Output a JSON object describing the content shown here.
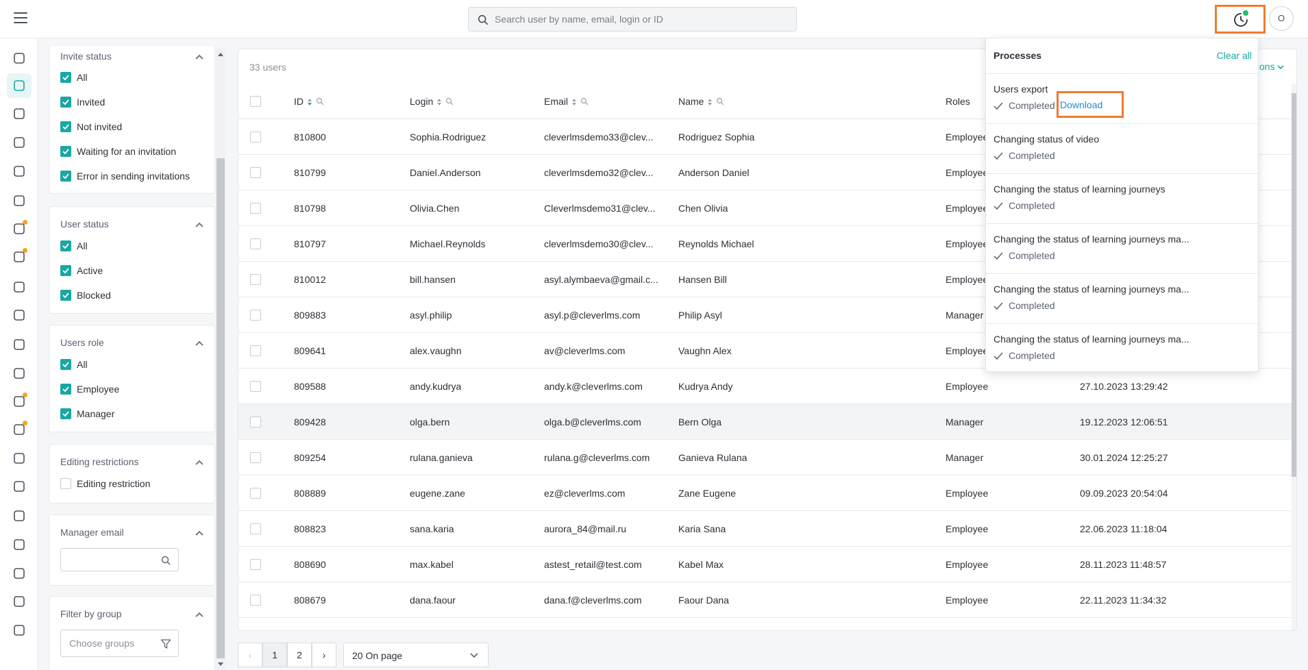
{
  "header": {
    "search_placeholder": "Search user by name, email, login or ID",
    "avatar_initial": "O"
  },
  "rail_icons": [
    "courses-icon",
    "users-icon",
    "settings-icon",
    "analytics-icon",
    "assignments-icon",
    "documents-icon",
    "skills-icon",
    "tasks-icon",
    "copy-icon",
    "help-icon",
    "calendar-icon",
    "info-icon",
    "chat-icon",
    "video-icon",
    "trophy-icon",
    "gift-icon",
    "user-check-icon",
    "trend-icon",
    "star-icon",
    "monitor-icon",
    "external-link-icon"
  ],
  "filters": {
    "invite_status": {
      "title": "Invite status",
      "options": [
        "All",
        "Invited",
        "Not invited",
        "Waiting for an invitation",
        "Error in sending invitations"
      ]
    },
    "user_status": {
      "title": "User status",
      "options": [
        "All",
        "Active",
        "Blocked"
      ]
    },
    "users_role": {
      "title": "Users role",
      "options": [
        "All",
        "Employee",
        "Manager"
      ]
    },
    "editing_restrictions": {
      "title": "Editing restrictions",
      "options": [
        "Editing restriction"
      ]
    },
    "manager_email": {
      "title": "Manager email",
      "placeholder": ""
    },
    "filter_by_group": {
      "title": "Filter by group",
      "placeholder": "Choose groups"
    }
  },
  "table": {
    "count_label": "33 users",
    "actions_peek": "tions",
    "columns": [
      "ID",
      "Login",
      "Email",
      "Name",
      "Roles"
    ],
    "rows": [
      {
        "id": "810800",
        "login": "Sophia.Rodriguez",
        "email": "cleverlmsdemo33@clev...",
        "name": "Rodriguez Sophia",
        "role": "Employee",
        "date": ""
      },
      {
        "id": "810799",
        "login": "Daniel.Anderson",
        "email": "cleverlmsdemo32@clev...",
        "name": "Anderson Daniel",
        "role": "Employee",
        "date": ""
      },
      {
        "id": "810798",
        "login": "Olivia.Chen",
        "email": "Cleverlmsdemo31@clev...",
        "name": "Chen Olivia",
        "role": "Employee",
        "date": ""
      },
      {
        "id": "810797",
        "login": "Michael.Reynolds",
        "email": "cleverlmsdemo30@clev...",
        "name": "Reynolds Michael",
        "role": "Employee",
        "date": ""
      },
      {
        "id": "810012",
        "login": "bill.hansen",
        "email": "asyl.alymbaeva@gmail.c...",
        "name": "Hansen Bill",
        "role": "Employee",
        "date": ""
      },
      {
        "id": "809883",
        "login": "asyl.philip",
        "email": "asyl.p@cleverlms.com",
        "name": "Philip Asyl",
        "role": "Manager",
        "date": ""
      },
      {
        "id": "809641",
        "login": "alex.vaughn",
        "email": "av@cleverlms.com",
        "name": "Vaughn Alex",
        "role": "Employee",
        "date": ""
      },
      {
        "id": "809588",
        "login": "andy.kudrya",
        "email": "andy.k@cleverlms.com",
        "name": "Kudrya Andy",
        "role": "Employee",
        "date": "27.10.2023 13:29:42"
      },
      {
        "id": "809428",
        "login": "olga.bern",
        "email": "olga.b@cleverlms.com",
        "name": "Bern Olga",
        "role": "Manager",
        "date": "19.12.2023 12:06:51"
      },
      {
        "id": "809254",
        "login": "rulana.ganieva",
        "email": "rulana.g@cleverlms.com",
        "name": "Ganieva Rulana",
        "role": "Manager",
        "date": "30.01.2024 12:25:27"
      },
      {
        "id": "808889",
        "login": "eugene.zane",
        "email": "ez@cleverlms.com",
        "name": "Zane Eugene",
        "role": "Employee",
        "date": "09.09.2023 20:54:04"
      },
      {
        "id": "808823",
        "login": "sana.karia",
        "email": "aurora_84@mail.ru",
        "name": "Karia Sana",
        "role": "Employee",
        "date": "22.06.2023 11:18:04"
      },
      {
        "id": "808690",
        "login": "max.kabel",
        "email": "astest_retail@test.com",
        "name": "Kabel Max",
        "role": "Employee",
        "date": "28.11.2023 11:48:57"
      },
      {
        "id": "808679",
        "login": "dana.faour",
        "email": "dana.f@cleverlms.com",
        "name": "Faour Dana",
        "role": "Employee",
        "date": "22.11.2023 11:34:32"
      }
    ]
  },
  "pagination": {
    "pages": [
      "1",
      "2"
    ],
    "page_size": "20 On page"
  },
  "processes": {
    "title": "Processes",
    "clear_all": "Clear all",
    "download_label": "Download",
    "items": [
      {
        "title": "Users export",
        "status": "Completed"
      },
      {
        "title": "Changing status of video",
        "status": "Completed"
      },
      {
        "title": "Changing the status of learning journeys",
        "status": "Completed"
      },
      {
        "title": "Changing the status of learning journeys ma...",
        "status": "Completed"
      },
      {
        "title": "Changing the status of learning journeys ma...",
        "status": "Completed"
      },
      {
        "title": "Changing the status of learning journeys ma...",
        "status": "Completed"
      }
    ]
  },
  "colors": {
    "accent": "#1aa7a4",
    "highlight": "#f07a2e",
    "link": "#1a8fcf",
    "badge": "#f4a21a",
    "online": "#1fbf69"
  }
}
